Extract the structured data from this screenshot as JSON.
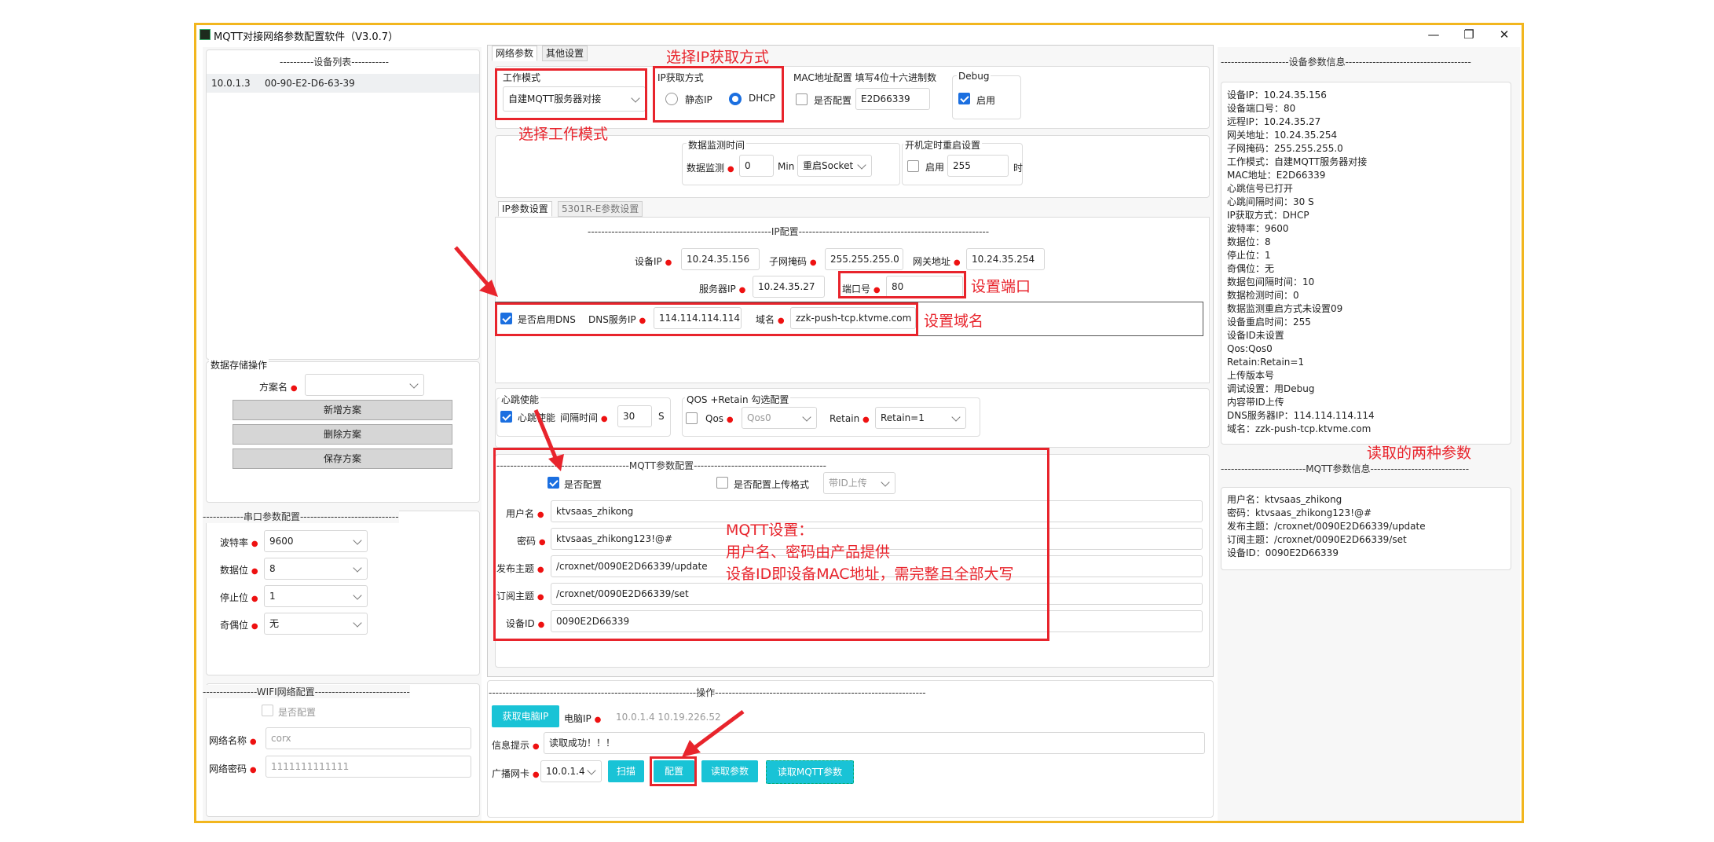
{
  "window": {
    "title": "MQTT对接网络参数配置软件（V3.0.7）",
    "min": "—",
    "restore": "❐",
    "close": "✕"
  },
  "left": {
    "device_list_title": "----------设备列表-----------",
    "device": {
      "ip": "10.0.1.3",
      "mac": "00-90-E2-D6-63-39"
    },
    "storage": {
      "title": "数据存储操作",
      "scheme_label": "方案名",
      "scheme_value": "",
      "add": "新增方案",
      "del": "删除方案",
      "save": "保存方案"
    },
    "serial": {
      "title": "------------串口参数配置-----------------------------",
      "rows": [
        {
          "label": "波特率",
          "value": "9600"
        },
        {
          "label": "数据位",
          "value": "8"
        },
        {
          "label": "停止位",
          "value": "1"
        },
        {
          "label": "奇偶位",
          "value": "无"
        }
      ]
    },
    "wifi": {
      "title": "----------------WIFI网络配置----------------------------",
      "enable": "是否配置",
      "ssid_label": "网络名称",
      "ssid": "corx",
      "pwd_label": "网络密码",
      "pwd": "1111111111111"
    }
  },
  "tabs": {
    "net": "网络参数",
    "other": "其他设置"
  },
  "mode": {
    "title": "工作模式",
    "value": "自建MQTT服务器对接"
  },
  "ipmode": {
    "title": "IP获取方式",
    "static": "静态IP",
    "dhcp": "DHCP"
  },
  "mac": {
    "title": "MAC地址配置 填写4位十六进制数",
    "enable": "是否配置",
    "value": "E2D66339"
  },
  "debug": {
    "title": "Debug",
    "enable": "启用"
  },
  "monitor": {
    "title": "数据监测时间",
    "label": "数据监测",
    "value": "0",
    "unit": "Min",
    "action": "重启Socket"
  },
  "reboot": {
    "title": "开机定时重启设置",
    "enable": "启用",
    "value": "255",
    "unit": "时"
  },
  "subtabs": {
    "ip": "IP参数设置",
    "r5301": "5301R-E参数设置"
  },
  "ipcfg": {
    "title": "------------------------------------------------------IP配置--------------------------------------------------------",
    "devip_label": "设备IP",
    "devip": "10.24.35.156",
    "mask_label": "子网掩码",
    "mask": "255.255.255.0",
    "gw_label": "网关地址",
    "gw": "10.24.35.254",
    "srvip_label": "服务器IP",
    "srvip": "10.24.35.27",
    "port_label": "端口号",
    "port": "80",
    "dns_enable": "是否启用DNS",
    "dns_label": "DNS服务IP",
    "dns": "114.114.114.114",
    "domain_label": "域名",
    "domain": "zzk-push-tcp.ktvme.com"
  },
  "heartbeat": {
    "title": "心跳使能",
    "enable": "心跳使能",
    "interval_label": "间隔时间",
    "interval": "30",
    "unit": "S"
  },
  "qos": {
    "title": "QOS +Retain 勾选配置",
    "qos_label": "Qos",
    "qos_value": "Qos0",
    "retain_label": "Retain",
    "retain_value": "Retain=1"
  },
  "mqtt": {
    "title": "---------------------------------------MQTT参数配置---------------------------------------",
    "enable": "是否配置",
    "upload_fmt": "是否配置上传格式",
    "upload_value": "带ID上传",
    "user_label": "用户名",
    "user": "ktvsaas_zhikong",
    "pwd_label": "密码",
    "pwd": "ktvsaas_zhikong123!@#",
    "pub_label": "发布主题",
    "pub": "/croxnet/0090E2D66339/update",
    "sub_label": "订阅主题",
    "sub": "/croxnet/0090E2D66339/set",
    "id_label": "设备ID",
    "id": "0090E2D66339"
  },
  "ops": {
    "title": "-------------------------------------------------------------操作--------------------------------------------------------------",
    "get_ip": "获取电脑IP",
    "pc_ip_label": "电脑IP",
    "pc_ip": "10.0.1.4   10.19.226.52",
    "msg_label": "信息提示",
    "msg": "读取成功！！！",
    "nic_label": "广播网卡",
    "nic": "10.0.1.4",
    "scan": "扫描",
    "config": "配置",
    "read": "读取参数",
    "read_mqtt": "读取MQTT参数"
  },
  "right": {
    "dev_title": "--------------------设备参数信息-------------------------------------",
    "dev_info": "设备IP：10.24.35.156\n设备端口号：80\n远程IP：10.24.35.27\n网关地址：10.24.35.254\n子网掩码：255.255.255.0\n工作模式：自建MQTT服务器对接\nMAC地址：E2D66339\n心跳信号已打开\n心跳间隔时间：30 S\nIP获取方式：DHCP\n波特率：9600\n数据位：8\n停止位：1\n奇偶位：无\n数据包间隔时间：10\n数据检测时间：0\n数据监测重启方式未设置09\n设备重启时间：255\n设备ID未设置\nQos:Qos0\nRetain:Retain=1\n上传版本号\n调试设置：用Debug\n内容带ID上传\nDNS服务器IP：114.114.114.114\n域名：zzk-push-tcp.ktvme.com",
    "mqtt_title": "-------------------------MQTT参数信息-----------------------------",
    "mqtt_info": "用户名：ktvsaas_zhikong\n密码：ktvsaas_zhikong123!@#\n发布主题：/croxnet/0090E2D66339/update\n订阅主题：/croxnet/0090E2D66339/set\n设备ID：0090E2D66339"
  },
  "annotations": {
    "ip_mode": "选择IP获取方式",
    "work_mode": "选择工作模式",
    "port": "设置端口",
    "domain": "设置域名",
    "mqtt_line1": "MQTT设置：",
    "mqtt_line2": "用户名、密码由产品提供",
    "mqtt_line3": "设备ID即设备MAC地址，需完整且全部大写",
    "read_both": "读取的两种参数",
    "accent": "#e8242c"
  }
}
